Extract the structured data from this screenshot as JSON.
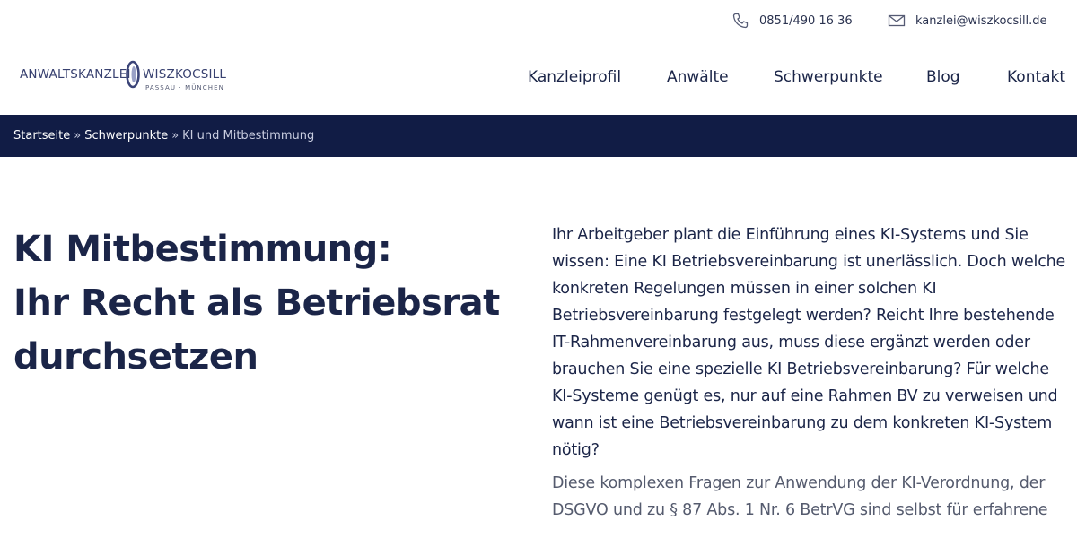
{
  "topbar": {
    "phone": {
      "icon": "phone-icon",
      "text": "0851/490 16 36"
    },
    "email": {
      "icon": "mail-icon",
      "text": "kanzlei@wiszkocsill.de"
    }
  },
  "logo": {
    "left_word": "ANWALTSKANZLEI",
    "right_word": "WISZKOCSILL",
    "subtitle": "PASSAU · MÜNCHEN"
  },
  "nav": {
    "items": [
      {
        "label": "Kanzleiprofil"
      },
      {
        "label": "Anwälte"
      },
      {
        "label": "Schwerpunkte"
      },
      {
        "label": "Blog"
      },
      {
        "label": "Kontakt"
      }
    ]
  },
  "breadcrumb": {
    "home": "Startseite",
    "separator": "»",
    "section": "Schwerpunkte",
    "current": "KI und Mitbestimmung"
  },
  "hero": {
    "title_lines": [
      "KI Mitbestimmung:",
      "Ihr Recht als Betriebsrat",
      "durchsetzen"
    ]
  },
  "content": {
    "paragraph1": "Ihr Arbeitgeber plant die Einführung eines KI-Systems und Sie wissen: Eine KI Betriebsvereinbarung ist unerlässlich. Doch welche konkreten Regelungen müssen in einer solchen KI Betriebsvereinbarung festgelegt werden? Reicht Ihre bestehende IT-Rahmenvereinbarung aus, muss diese ergänzt werden oder brauchen Sie eine spezielle KI Betriebsvereinbarung? Für welche KI-Systeme genügt es, nur auf eine Rahmen BV zu verweisen und wann ist eine Betriebsvereinbarung zu dem konkreten KI-System nötig?",
    "paragraph2": "Diese komplexen Fragen zur Anwendung der KI-Verordnung, der DSGVO und zu § 87 Abs. 1 Nr. 6 BetrVG sind selbst für erfahrene"
  },
  "colors": {
    "navy": "#111c45",
    "heading": "#1b2548",
    "muted_text": "#555b6e"
  }
}
